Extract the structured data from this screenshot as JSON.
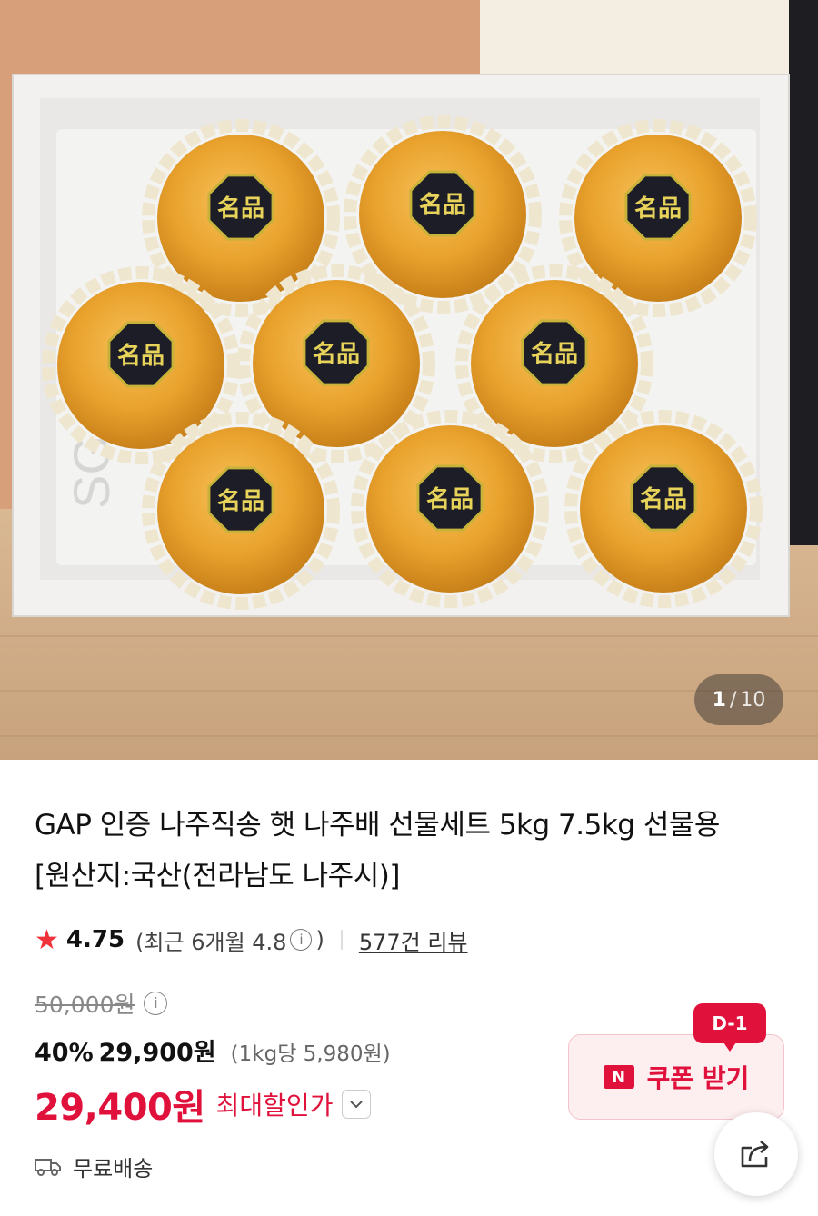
{
  "gallery": {
    "current": "1",
    "total": "10",
    "fruit_label": "名品"
  },
  "product": {
    "title": "GAP 인증 나주직송 햇 나주배 선물세트 5kg 7.5kg 선물용 [원산지:국산(전라남도 나주시)]"
  },
  "rating": {
    "score": "4.75",
    "recent_open": "(최근 6개월 4.8",
    "recent_close": ")",
    "info_icon": "ⓘ",
    "reviews": "577건 리뷰"
  },
  "price": {
    "original": "50,000원",
    "discount_rate": "40%",
    "sale": "29,900원",
    "unit_price": "(1kg당 5,980원)",
    "max_discount_price": "29,400원",
    "max_discount_label": "최대할인가"
  },
  "coupon": {
    "badge": "D-1",
    "n_logo": "N",
    "label": "쿠폰 받기"
  },
  "shipping": {
    "label": "무료배송"
  },
  "colors": {
    "accent": "#e0113b",
    "star": "#f0323a"
  }
}
